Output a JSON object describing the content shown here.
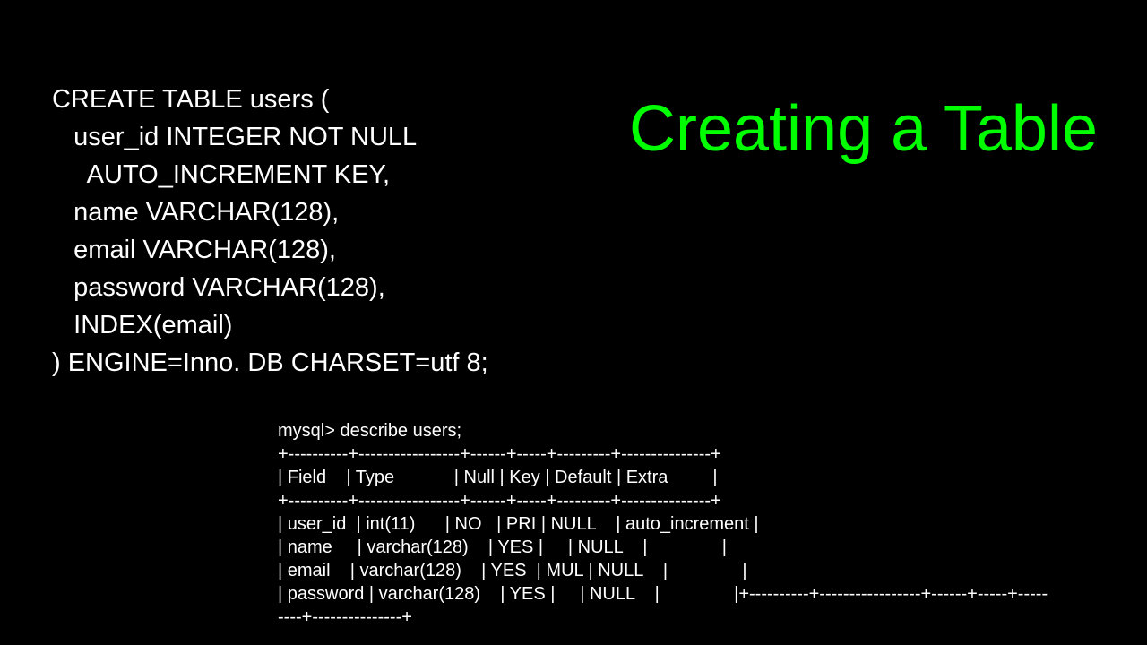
{
  "heading": "Creating a\nTable",
  "sql": "CREATE TABLE users (\n   user_id INTEGER NOT NULL\n     AUTO_INCREMENT KEY,\n   name VARCHAR(128),\n   email VARCHAR(128),\n   password VARCHAR(128),\n   INDEX(email)\n) ENGINE=Inno. DB CHARSET=utf 8;",
  "describe": "mysql> describe users;\n+----------+-----------------+------+-----+---------+---------------+\n| Field    | Type            | Null | Key | Default | Extra         |\n+----------+-----------------+------+-----+---------+---------------+\n| user_id  | int(11)      | NO   | PRI | NULL    | auto_increment |\n| name     | varchar(128)    | YES |     | NULL    |               |\n| email    | varchar(128)    | YES  | MUL | NULL    |               |\n| password | varchar(128)    | YES |     | NULL    |               |+----------+-----------------+------+-----+-----\n----+---------------+"
}
